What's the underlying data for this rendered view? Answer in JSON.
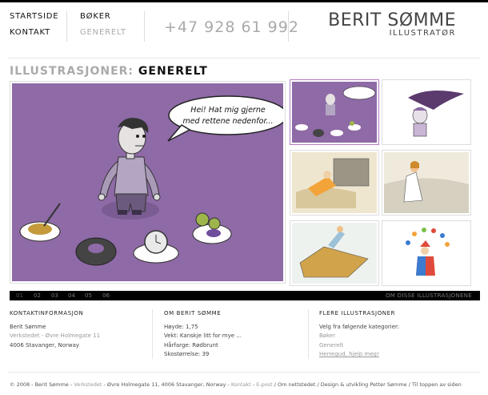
{
  "nav": {
    "col1": [
      "STARTSIDE",
      "KONTAKT"
    ],
    "col2": [
      "BØKER",
      "GENERELT"
    ]
  },
  "phone": "+47 928 61 992",
  "logo": {
    "name": "BERIT SØMME",
    "subtitle": "ILLUSTRATØR"
  },
  "page_title": {
    "section": "ILLUSTRASJONER:",
    "category": "GENERELT"
  },
  "speech_bubble": [
    "Hei! Hat mig gjerne",
    "med rettene nedenfor..."
  ],
  "pager": {
    "pages": [
      "01",
      "02",
      "03",
      "04",
      "05",
      "06"
    ],
    "more_link": "OM DISSE ILLUSTRASJONENE"
  },
  "contact": {
    "heading": "KONTAKTINFORMASJON",
    "name": "Berit Sømme",
    "address_link": "Verkstedet - Øvre Holmegate 11",
    "city": "4006 Stavanger, Norway"
  },
  "about": {
    "heading": "OM BERIT SØMME",
    "lines": [
      "Høyde: 1,75",
      "Vekt: Kanskje litt for mye ...",
      "Hårfarge: Rødbrunt",
      "Skostørrelse: 39"
    ]
  },
  "more": {
    "heading": "FLERE ILLUSTRASJONER",
    "intro": "Velg fra følgende kategorier:",
    "links": [
      "Bøker",
      "Generelt"
    ],
    "help": "Herregud, hjelp meg!"
  },
  "footer": {
    "copyright": "© 2008 - Berit Sømme - ",
    "workshop": "Verkstedet",
    "address": " - Øvre Holmegate 11, 4006 Stavanger, Norway - ",
    "links": [
      "Kontakt",
      "E-post",
      "Om nettstedet",
      "Design & utvikling Petter Sømme",
      "Til toppen av siden"
    ]
  },
  "colors": {
    "purple": "#8e6aa6",
    "accent_border": "#b57ac0"
  }
}
